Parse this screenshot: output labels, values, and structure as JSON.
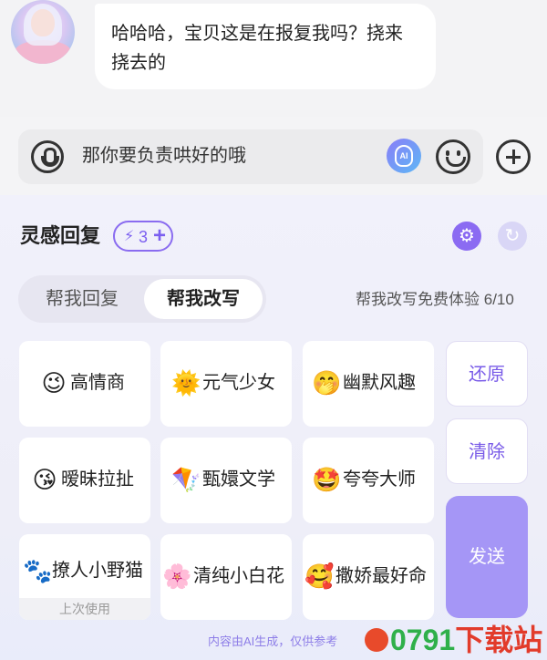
{
  "chat": {
    "message": "哈哈哈，宝贝这是在报复我吗？挠来挠去的"
  },
  "input": {
    "value": "那你要负责哄好的哦",
    "ai_icon_text": "AI"
  },
  "panel": {
    "title": "灵感回复",
    "credit": {
      "icon": "⚡",
      "count": "3",
      "plus": "+"
    },
    "settings_icon": "⚙",
    "refresh_icon": "↻",
    "tabs": [
      {
        "label": "帮我回复",
        "active": false
      },
      {
        "label": "帮我改写",
        "active": true
      }
    ],
    "trial": {
      "text": "帮我改写免费体验 ",
      "count": "6/10"
    },
    "styles": [
      {
        "emoji": "😉",
        "label": "高情商"
      },
      {
        "emoji": "🌞",
        "label": "元气少女"
      },
      {
        "emoji": "🤭",
        "label": "幽默风趣"
      },
      {
        "emoji": "😘",
        "label": "暧昧拉扯"
      },
      {
        "emoji": "🪁",
        "label": "甄嬛文学"
      },
      {
        "emoji": "🤩",
        "label": "夸夸大师"
      },
      {
        "emoji": "🐾",
        "label": "撩人小野猫",
        "sub": "上次使用"
      },
      {
        "emoji": "🌸",
        "label": "清纯小白花"
      },
      {
        "emoji": "🥰",
        "label": "撒娇最好命"
      }
    ],
    "actions": {
      "restore": "还原",
      "clear": "清除",
      "send": "发送"
    },
    "disclaimer": "内容由AI生成，仅供参考"
  },
  "watermark": {
    "digits": "0791",
    "suffix": "下载站"
  },
  "colors": {
    "accent": "#8b6bf2",
    "send": "#a596f6",
    "bubble": "#ffffff"
  }
}
